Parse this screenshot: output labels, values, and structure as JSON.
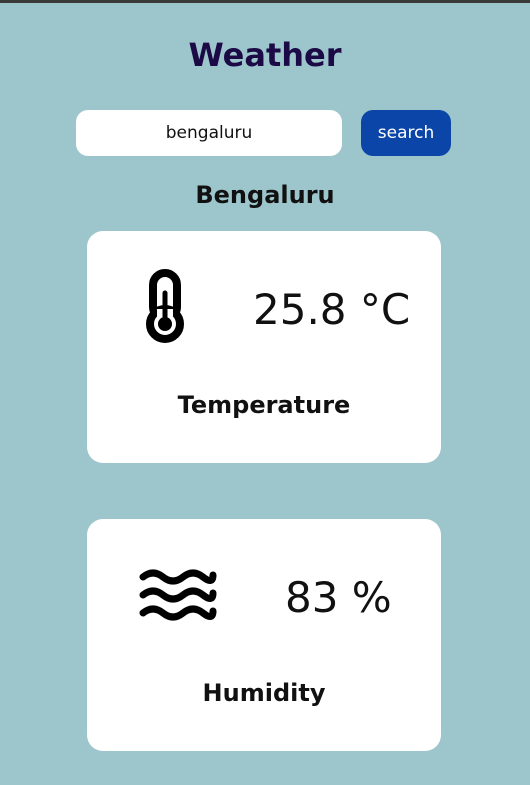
{
  "app": {
    "title": "Weather"
  },
  "search": {
    "value": "bengaluru",
    "button_label": "search"
  },
  "location": {
    "city": "Bengaluru"
  },
  "cards": {
    "temperature": {
      "value": "25.8 °C",
      "label": "Temperature",
      "icon": "thermometer-icon"
    },
    "humidity": {
      "value": "83 %",
      "label": "Humidity",
      "icon": "water-waves-icon"
    }
  },
  "colors": {
    "background": "#9dc6cc",
    "title": "#1b0a45",
    "button": "#0c45a8",
    "card": "#ffffff"
  }
}
